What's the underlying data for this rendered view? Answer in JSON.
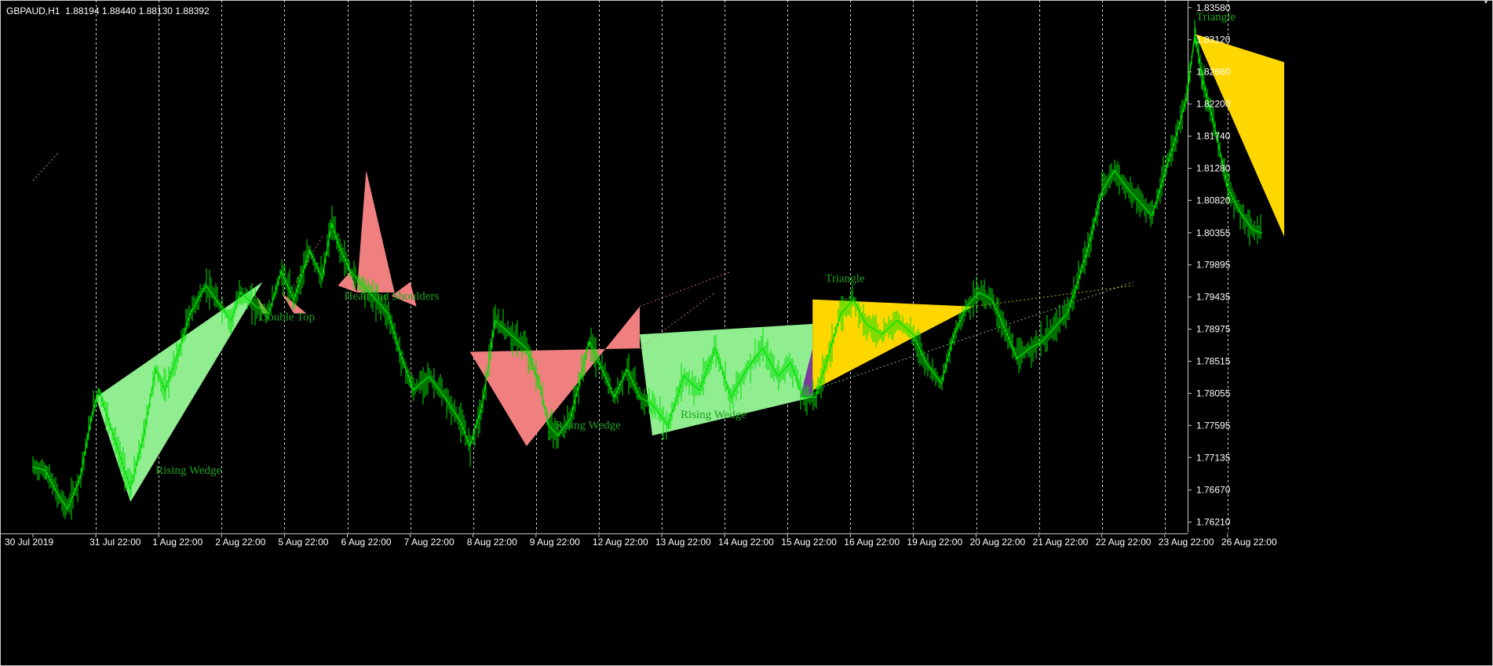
{
  "header": {
    "symbol": "GBPAUD,H1",
    "quote": "1.88194 1.88440 1.88130 1.88392"
  },
  "colors": {
    "background": "#000000",
    "candles": "#00e000",
    "grid": "#ffffff",
    "axis_text": "#ffffff",
    "pattern_label": "#1ea21e",
    "rising_wedge_fill": "#90ee90",
    "bearish_fill": "#f08080",
    "triangle_fill": "#ffd700",
    "purple_fill": "#7a3b9a"
  },
  "chart_data": {
    "type": "line",
    "title": "",
    "xlabel": "",
    "ylabel": "",
    "grid": true,
    "ylim": [
      1.7606,
      1.8369
    ],
    "y_ticks": [
      "1.83580",
      "1.83120",
      "1.82660",
      "1.82200",
      "1.81740",
      "1.81280",
      "1.80820",
      "1.80355",
      "1.79895",
      "1.79435",
      "1.78975",
      "1.78515",
      "1.78055",
      "1.77595",
      "1.77135",
      "1.76670",
      "1.76210"
    ],
    "x_ticks": [
      "30 Jul 2019",
      "31 Jul 22:00",
      "1 Aug 22:00",
      "2 Aug 22:00",
      "5 Aug 22:00",
      "6 Aug 22:00",
      "7 Aug 22:00",
      "8 Aug 22:00",
      "9 Aug 22:00",
      "12 Aug 22:00",
      "13 Aug 22:00",
      "14 Aug 22:00",
      "15 Aug 22:00",
      "16 Aug 22:00",
      "19 Aug 22:00",
      "20 Aug 22:00",
      "21 Aug 22:00",
      "22 Aug 22:00",
      "23 Aug 22:00",
      "26 Aug 22:00"
    ],
    "x_tick_index": [
      0,
      1,
      2,
      3,
      4,
      5,
      6,
      7,
      8,
      9,
      10,
      11,
      12,
      13,
      14,
      15,
      16,
      17,
      18,
      19
    ],
    "series": [
      {
        "values": [
          [
            0,
            1.77
          ],
          [
            0.2,
            1.7695
          ],
          [
            0.4,
            1.766
          ],
          [
            0.55,
            1.764
          ],
          [
            0.75,
            1.7685
          ],
          [
            0.95,
            1.778
          ],
          [
            1.05,
            1.781
          ],
          [
            1.3,
            1.774
          ],
          [
            1.55,
            1.767
          ],
          [
            1.75,
            1.774
          ],
          [
            1.95,
            1.784
          ],
          [
            2.1,
            1.781
          ],
          [
            2.3,
            1.786
          ],
          [
            2.5,
            1.792
          ],
          [
            2.75,
            1.796
          ],
          [
            2.95,
            1.7935
          ],
          [
            3.15,
            1.791
          ],
          [
            3.3,
            1.795
          ],
          [
            3.55,
            1.793
          ],
          [
            3.75,
            1.792
          ],
          [
            3.95,
            1.798
          ],
          [
            4.15,
            1.794
          ],
          [
            4.4,
            1.801
          ],
          [
            4.6,
            1.797
          ],
          [
            4.75,
            1.805
          ],
          [
            4.85,
            1.802
          ],
          [
            5.05,
            1.798
          ],
          [
            5.25,
            1.796
          ],
          [
            5.45,
            1.794
          ],
          [
            5.65,
            1.792
          ],
          [
            5.85,
            1.786
          ],
          [
            6.05,
            1.781
          ],
          [
            6.3,
            1.783
          ],
          [
            6.55,
            1.78
          ],
          [
            6.8,
            1.7765
          ],
          [
            6.95,
            1.773
          ],
          [
            7.15,
            1.779
          ],
          [
            7.35,
            1.791
          ],
          [
            7.6,
            1.789
          ],
          [
            7.85,
            1.787
          ],
          [
            8.05,
            1.782
          ],
          [
            8.2,
            1.776
          ],
          [
            8.35,
            1.7745
          ],
          [
            8.55,
            1.777
          ],
          [
            8.85,
            1.788
          ],
          [
            9.05,
            1.784
          ],
          [
            9.25,
            1.78
          ],
          [
            9.45,
            1.784
          ],
          [
            9.65,
            1.78
          ],
          [
            9.85,
            1.779
          ],
          [
            10.1,
            1.776
          ],
          [
            10.35,
            1.783
          ],
          [
            10.6,
            1.781
          ],
          [
            10.85,
            1.787
          ],
          [
            11.1,
            1.78
          ],
          [
            11.35,
            1.784
          ],
          [
            11.6,
            1.787
          ],
          [
            11.85,
            1.783
          ],
          [
            12.05,
            1.785
          ],
          [
            12.25,
            1.78
          ],
          [
            12.45,
            1.78
          ],
          [
            12.65,
            1.786
          ],
          [
            12.85,
            1.792
          ],
          [
            13.05,
            1.794
          ],
          [
            13.25,
            1.7905
          ],
          [
            13.5,
            1.789
          ],
          [
            13.75,
            1.791
          ],
          [
            14.0,
            1.789
          ],
          [
            14.2,
            1.785
          ],
          [
            14.45,
            1.782
          ],
          [
            14.65,
            1.789
          ],
          [
            14.85,
            1.793
          ],
          [
            15.05,
            1.795
          ],
          [
            15.25,
            1.794
          ],
          [
            15.45,
            1.79
          ],
          [
            15.65,
            1.7855
          ],
          [
            15.85,
            1.787
          ],
          [
            16.05,
            1.788
          ],
          [
            16.25,
            1.79
          ],
          [
            16.45,
            1.792
          ],
          [
            16.6,
            1.796
          ],
          [
            16.8,
            1.802
          ],
          [
            17.0,
            1.8095
          ],
          [
            17.2,
            1.8125
          ],
          [
            17.4,
            1.81
          ],
          [
            17.6,
            1.808
          ],
          [
            17.8,
            1.806
          ],
          [
            18.0,
            1.812
          ],
          [
            18.2,
            1.818
          ],
          [
            18.35,
            1.823
          ],
          [
            18.48,
            1.832
          ],
          [
            18.6,
            1.8255
          ],
          [
            18.8,
            1.8185
          ],
          [
            19.0,
            1.81
          ],
          [
            19.2,
            1.8065
          ],
          [
            19.4,
            1.804
          ],
          [
            19.55,
            1.8035
          ]
        ]
      }
    ],
    "patterns": [
      {
        "name": "Rising Wedge",
        "kind": "bull",
        "poly": [
          [
            1.0,
            1.78
          ],
          [
            1.55,
            1.765
          ],
          [
            3.65,
            1.7965
          ]
        ],
        "label_at": [
          1.95,
          1.769
        ]
      },
      {
        "name": "Double Top",
        "kind": "bear",
        "poly": [
          [
            3.55,
            1.7945
          ],
          [
            3.65,
            1.792
          ],
          [
            3.75,
            1.792
          ]
        ],
        "label_at": [
          3.6,
          1.791
        ]
      },
      {
        "name": "",
        "kind": "bear",
        "poly": [
          [
            3.95,
            1.795
          ],
          [
            4.15,
            1.792
          ],
          [
            4.35,
            1.792
          ]
        ],
        "label_at": null
      },
      {
        "name": "Head and Shoulders",
        "kind": "bear",
        "poly": [
          [
            4.85,
            1.796
          ],
          [
            5.05,
            1.798
          ],
          [
            5.15,
            1.795
          ]
        ],
        "label_at": [
          4.95,
          1.794
        ]
      },
      {
        "name": "",
        "kind": "bear",
        "poly": [
          [
            5.15,
            1.795
          ],
          [
            5.3,
            1.8125
          ],
          [
            5.75,
            1.795
          ]
        ],
        "label_at": null
      },
      {
        "name": "",
        "kind": "bear",
        "poly": [
          [
            5.7,
            1.7945
          ],
          [
            6.0,
            1.7965
          ],
          [
            6.1,
            1.793
          ]
        ],
        "label_at": null
      },
      {
        "name": "Rising Wedge",
        "kind": "bear",
        "poly": [
          [
            6.95,
            1.7865
          ],
          [
            7.85,
            1.773
          ],
          [
            9.65,
            1.793
          ],
          [
            9.65,
            1.787
          ]
        ],
        "label_at": [
          8.3,
          1.7755
        ]
      },
      {
        "name": "Rising Wedge",
        "kind": "bull",
        "poly": [
          [
            9.65,
            1.789
          ],
          [
            9.85,
            1.7745
          ],
          [
            12.4,
            1.78
          ],
          [
            12.4,
            1.7905
          ]
        ],
        "label_at": [
          10.3,
          1.777
        ]
      },
      {
        "name": "",
        "kind": "purple",
        "poly": [
          [
            12.2,
            1.78
          ],
          [
            12.4,
            1.78
          ],
          [
            12.4,
            1.787
          ]
        ],
        "label_at": null
      },
      {
        "name": "Triangle",
        "kind": "triangle",
        "poly": [
          [
            12.4,
            1.794
          ],
          [
            12.4,
            1.781
          ],
          [
            14.95,
            1.793
          ]
        ],
        "label_at": [
          12.6,
          1.7965
        ]
      },
      {
        "name": "Triangle",
        "kind": "triangle",
        "poly": [
          [
            18.49,
            1.832
          ],
          [
            19.9,
            1.828
          ],
          [
            19.9,
            1.803
          ]
        ],
        "label_at": [
          18.5,
          1.834
        ]
      }
    ],
    "dotted_lines": [
      {
        "kind": "bear",
        "pts": [
          [
            9.65,
            1.793
          ],
          [
            11.1,
            1.798
          ]
        ]
      },
      {
        "kind": "bear",
        "pts": [
          [
            9.65,
            1.787
          ],
          [
            10.85,
            1.795
          ]
        ]
      },
      {
        "kind": "bear",
        "pts": [
          [
            4.15,
            1.796
          ],
          [
            4.6,
            1.803
          ]
        ]
      },
      {
        "kind": "bull",
        "pts": [
          [
            12.4,
            1.781
          ],
          [
            17.5,
            1.7965
          ]
        ]
      },
      {
        "kind": "triangle",
        "pts": [
          [
            14.95,
            1.793
          ],
          [
            17.5,
            1.796
          ]
        ]
      },
      {
        "kind": "bull",
        "pts": [
          [
            0.0,
            1.811
          ],
          [
            0.4,
            1.815
          ]
        ]
      }
    ]
  }
}
